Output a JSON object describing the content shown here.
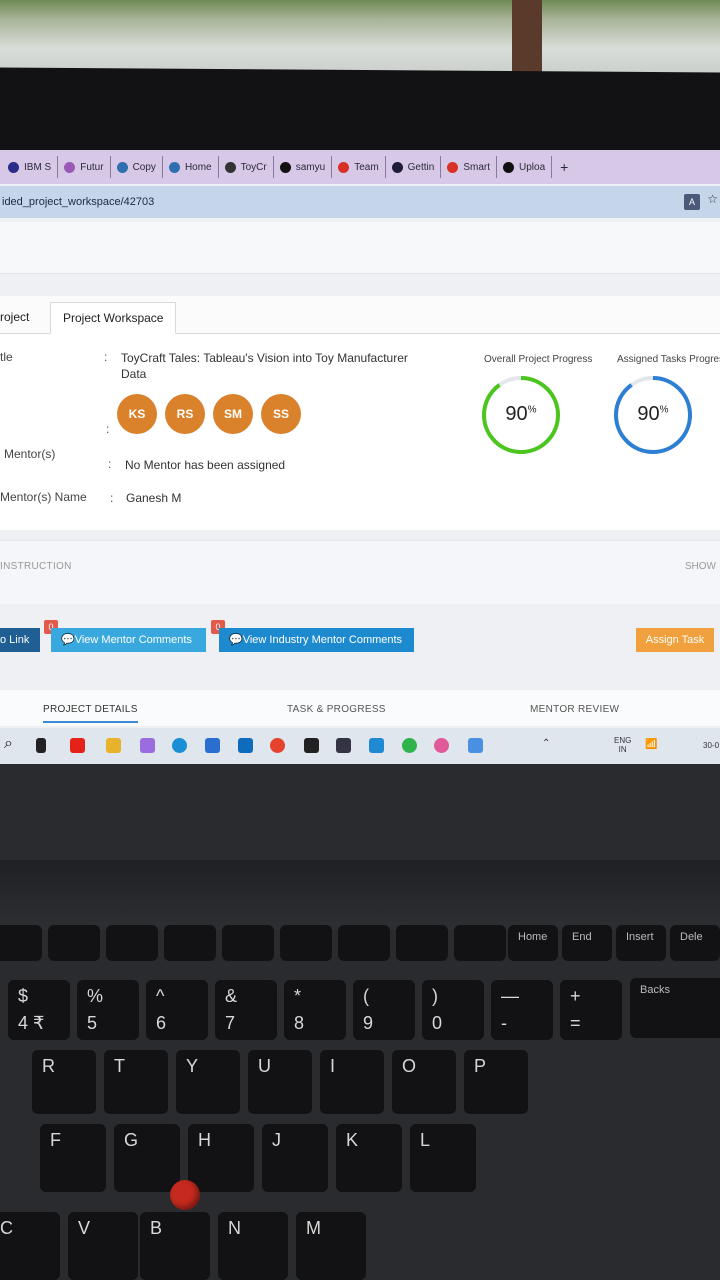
{
  "browser": {
    "tabs": [
      {
        "label": "IBM S",
        "icon": "ibm-icon",
        "color": "#2b2b8a"
      },
      {
        "label": "Futur",
        "icon": "sparkle-icon",
        "color": "#9b59b6"
      },
      {
        "label": "Copy",
        "icon": "drive-icon",
        "color": "#2f6fb0"
      },
      {
        "label": "Home",
        "icon": "drive-icon",
        "color": "#2f6fb0"
      },
      {
        "label": "ToyCr",
        "icon": "app-icon",
        "color": "#333333"
      },
      {
        "label": "samyu",
        "icon": "github-icon",
        "color": "#111111"
      },
      {
        "label": "Team",
        "icon": "gmail-icon",
        "color": "#d93025"
      },
      {
        "label": "Gettin",
        "icon": "doc-icon",
        "color": "#1d1d3a"
      },
      {
        "label": "Smart",
        "icon": "gmail-icon",
        "color": "#d93025"
      },
      {
        "label": "Uploa",
        "icon": "github-icon",
        "color": "#111111"
      }
    ],
    "new_tab": "+",
    "url": "ided_project_workspace/42703"
  },
  "project_tabs": {
    "first": "roject",
    "active": "Project Workspace"
  },
  "details": {
    "title_label": "tle",
    "colon": ":",
    "title_value_line1": "ToyCraft Tales: Tableau's Vision into Toy Manufacturer",
    "title_value_line2": "Data",
    "team": [
      "KS",
      "RS",
      "SM",
      "SS"
    ],
    "mentor_label": "Mentor(s)",
    "mentor_value": "No Mentor has been assigned",
    "mentor_name_label": "Mentor(s) Name",
    "mentor_name_value": "Ganesh M"
  },
  "progress": {
    "overall_label": "Overall Project Progress",
    "overall_value": "90",
    "overall_fraction": 0.9,
    "overall_color": "#4cc51f",
    "assigned_label": "Assigned Tasks Progres",
    "assigned_value": "90",
    "assigned_fraction": 0.9,
    "assigned_color": "#2d7fd3",
    "percent_sign": "%"
  },
  "instruction": {
    "label": "INSTRUCTION",
    "toggle": "SHOW"
  },
  "actions": {
    "link": "o Link",
    "mentor_comments": "View Mentor Comments",
    "mentor_count": "0",
    "industry_comments": "View Industry Mentor Comments",
    "industry_count": "0",
    "assign": "Assign Task"
  },
  "bottom_tabs": {
    "details": "PROJECT DETAILS",
    "task": "TASK & PROGRESS",
    "review": "MENTOR REVIEW"
  },
  "taskbar": {
    "lang_line1": "ENG",
    "lang_line2": "IN",
    "date_partial": "30-0"
  },
  "keyboard": {
    "fn_row": [
      "Home",
      "End",
      "Insert",
      "Dele"
    ],
    "num_row_top": [
      "$",
      "%",
      "^",
      "&",
      "*",
      "(",
      ")",
      "—",
      "+"
    ],
    "num_row_bottom": [
      "4 ₹",
      "5",
      "6",
      "7",
      "8",
      "9",
      "0",
      "-",
      "="
    ],
    "backspace": "Backs",
    "row_q": [
      "R",
      "T",
      "Y",
      "U",
      "I",
      "O",
      "P"
    ],
    "row_a": [
      "F",
      "G",
      "H",
      "J",
      "K",
      "L"
    ],
    "row_z": [
      "C",
      "V",
      "B",
      "N",
      "M"
    ]
  }
}
